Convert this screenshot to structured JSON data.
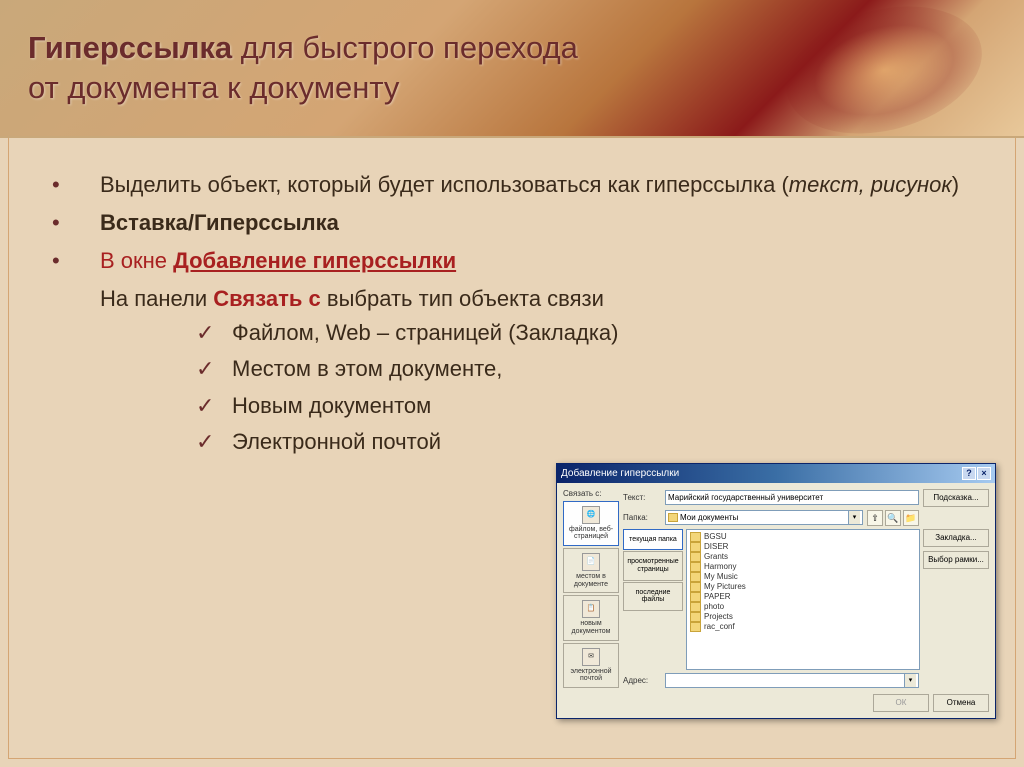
{
  "header": {
    "title_bold": "Гиперссылка",
    "title_rest1": " для быстрого перехода",
    "title_rest2": "от документа к документу"
  },
  "bullets": {
    "b1a": "Выделить объект, который будет использоваться как гиперссылка (",
    "b1b": "текст, рисунок",
    "b1c": ")",
    "b2": "Вставка/Гиперссылка",
    "b3a": "В окне ",
    "b3b": "Добавление гиперссылки",
    "sub_a": "На панели ",
    "sub_b": "Связать с",
    "sub_c": " выбрать тип объекта связи"
  },
  "checks": {
    "c1": "Файлом, Web – страницей (Закладка)",
    "c2": "Местом в этом документе,",
    "c3": "Новым документом",
    "c4": "Электронной почтой"
  },
  "dialog": {
    "title": "Добавление гиперссылки",
    "link_label": "Связать с:",
    "text_label": "Текст:",
    "text_value": "Марийский государственный университет",
    "folder_label": "Папка:",
    "folder_value": "Мои документы",
    "address_label": "Адрес:",
    "left": {
      "l1": "файлом, веб-страницей",
      "l2": "местом в документе",
      "l3": "новым документом",
      "l4": "электронной почтой"
    },
    "tabs": {
      "t1": "текущая папка",
      "t2": "просмотренные страницы",
      "t3": "последние файлы"
    },
    "files": {
      "f0": "BGSU",
      "f1": "DISER",
      "f2": "Grants",
      "f3": "Harmony",
      "f4": "My Music",
      "f5": "My Pictures",
      "f6": "PAPER",
      "f7": "photo",
      "f8": "Projects",
      "f9": "rac_conf"
    },
    "buttons": {
      "hint": "Подсказка...",
      "bookmark": "Закладка...",
      "frame": "Выбор рамки...",
      "ok": "ОК",
      "cancel": "Отмена"
    }
  }
}
